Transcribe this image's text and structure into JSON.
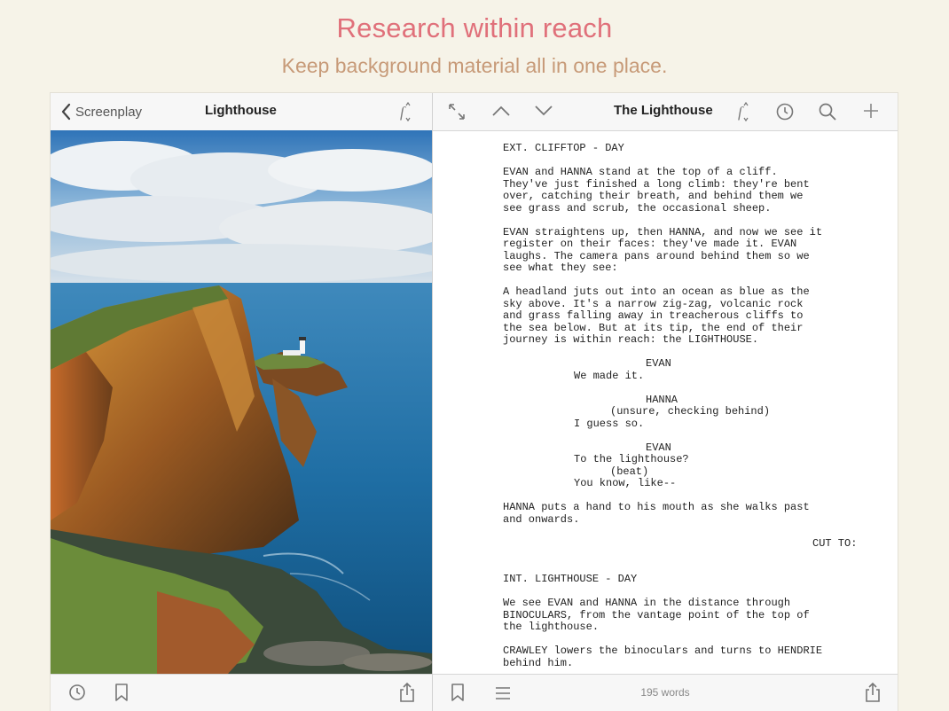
{
  "marketing": {
    "headline": "Research within reach",
    "subheadline": "Keep background material all in one place."
  },
  "colors": {
    "headline": "#e0707a",
    "subheadline": "#c79a78",
    "background": "#f6f3e8"
  },
  "left_pane": {
    "back_label": "Screenplay",
    "title": "Lighthouse",
    "top_icons": [
      "font-settings-icon"
    ],
    "bottom_icons": [
      "clock-icon",
      "bookmark-icon",
      "share-icon"
    ]
  },
  "right_pane": {
    "title": "The Lighthouse",
    "top_icons": [
      "expand-icon",
      "chevron-up-icon",
      "chevron-down-icon",
      "font-settings-icon",
      "history-icon",
      "search-icon",
      "add-icon"
    ],
    "bottom_icons": [
      "bookmark-icon",
      "outline-list-icon",
      "share-icon"
    ],
    "word_count": "195 words",
    "script_lines": [
      {
        "text": "EXT. CLIFFTOP - DAY",
        "indent": 0
      },
      {
        "text": "",
        "indent": 0
      },
      {
        "text": "EVAN and HANNA stand at the top of a cliff.",
        "indent": 0
      },
      {
        "text": "They've just finished a long climb: they're bent",
        "indent": 0
      },
      {
        "text": "over, catching their breath, and behind them we",
        "indent": 0
      },
      {
        "text": "see grass and scrub, the occasional sheep.",
        "indent": 0
      },
      {
        "text": "",
        "indent": 0
      },
      {
        "text": "EVAN straightens up, then HANNA, and now we see it",
        "indent": 0
      },
      {
        "text": "register on their faces: they've made it. EVAN",
        "indent": 0
      },
      {
        "text": "laughs. The camera pans around behind them so we",
        "indent": 0
      },
      {
        "text": "see what they see:",
        "indent": 0
      },
      {
        "text": "",
        "indent": 0
      },
      {
        "text": "A headland juts out into an ocean as blue as the",
        "indent": 0
      },
      {
        "text": "sky above. It's a narrow zig-zag, volcanic rock",
        "indent": 0
      },
      {
        "text": "and grass falling away in treacherous cliffs to",
        "indent": 0
      },
      {
        "text": "the sea below. But at its tip, the end of their",
        "indent": 0
      },
      {
        "text": "journey is within reach: the LIGHTHOUSE.",
        "indent": 0
      },
      {
        "text": "",
        "indent": 0
      },
      {
        "text": "EVAN",
        "indent": 2
      },
      {
        "text": "We made it.",
        "indent": 1
      },
      {
        "text": "",
        "indent": 0
      },
      {
        "text": "HANNA",
        "indent": 2
      },
      {
        "text": "(unsure, checking behind)",
        "indent": 3
      },
      {
        "text": "I guess so.",
        "indent": 1
      },
      {
        "text": "",
        "indent": 0
      },
      {
        "text": "EVAN",
        "indent": 2
      },
      {
        "text": "To the lighthouse?",
        "indent": 1
      },
      {
        "text": "(beat)",
        "indent": 3
      },
      {
        "text": "You know, like--",
        "indent": 1
      },
      {
        "text": "",
        "indent": 0
      },
      {
        "text": "HANNA puts a hand to his mouth as she walks past",
        "indent": 0
      },
      {
        "text": "and onwards.",
        "indent": 0
      },
      {
        "text": "",
        "indent": 0
      },
      {
        "text": "CUT TO:",
        "indent": 4
      },
      {
        "text": "",
        "indent": 0
      },
      {
        "text": "",
        "indent": 0
      },
      {
        "text": "INT. LIGHTHOUSE - DAY",
        "indent": 0
      },
      {
        "text": "",
        "indent": 0
      },
      {
        "text": "We see EVAN and HANNA in the distance through",
        "indent": 0
      },
      {
        "text": "BINOCULARS, from the vantage point of the top of",
        "indent": 0
      },
      {
        "text": "the lighthouse.",
        "indent": 0
      },
      {
        "text": "",
        "indent": 0
      },
      {
        "text": "CRAWLEY lowers the binoculars and turns to HENDRIE",
        "indent": 0
      },
      {
        "text": "behind him.",
        "indent": 0
      }
    ]
  }
}
